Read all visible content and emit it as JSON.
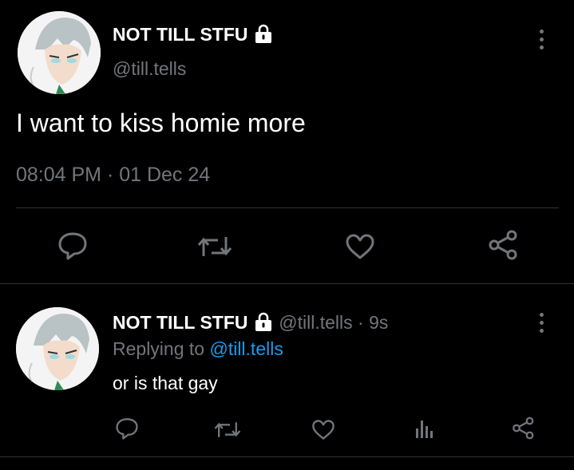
{
  "main_tweet": {
    "display_name": "NOT TILL STFU",
    "handle": "@till.tells",
    "text": "I want to kiss homie more",
    "timestamp": "08:04 PM · 01 Dec 24",
    "actions": [
      "reply-icon",
      "retweet-icon",
      "like-icon",
      "share-icon"
    ]
  },
  "reply_tweet": {
    "display_name": "NOT TILL STFU",
    "handle_time": "@till.tells · 9s",
    "replying_prefix": "Replying to ",
    "replying_to": "@till.tells",
    "text": "or is that gay",
    "actions": [
      "reply-icon",
      "retweet-icon",
      "like-icon",
      "analytics-icon",
      "share-icon"
    ]
  },
  "colors": {
    "background": "#000000",
    "text": "#e7e9ea",
    "muted": "#71767b",
    "link": "#1d9bf0",
    "divider": "#2f3336"
  }
}
